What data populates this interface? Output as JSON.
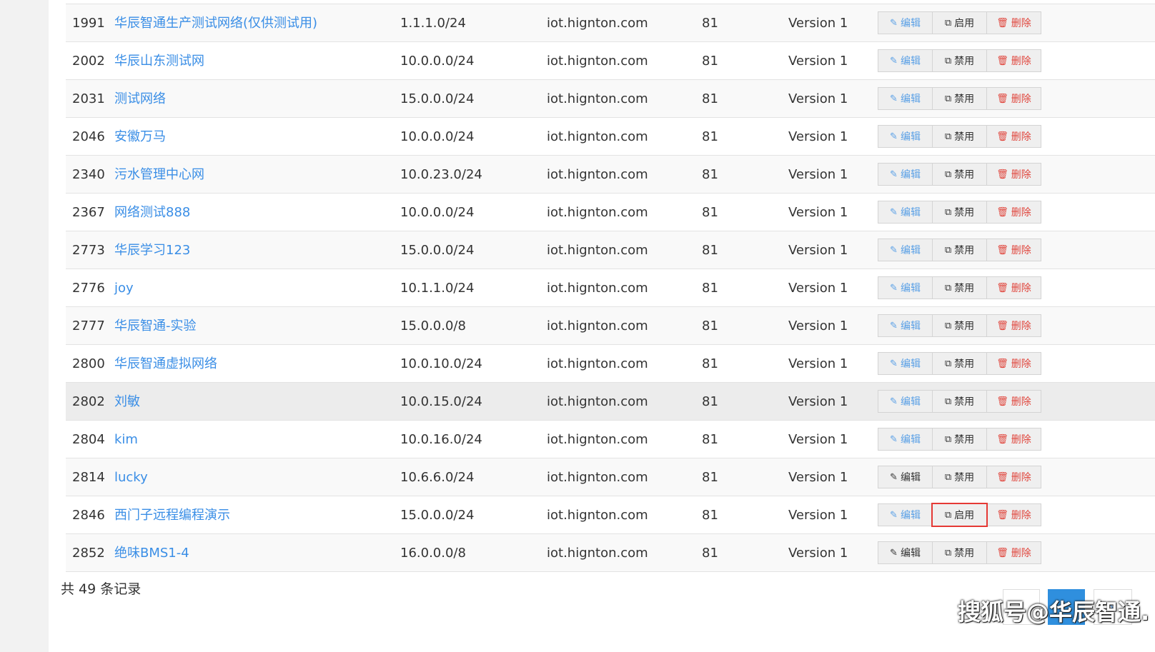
{
  "rows": [
    {
      "id": "1991",
      "name": "华辰智通生产测试网络(仅供测试用)",
      "cidr": "1.1.1.0/24",
      "host": "iot.hignton.com",
      "port": "81",
      "version": "Version 1",
      "toggle": "启用"
    },
    {
      "id": "2002",
      "name": "华辰山东测试网",
      "cidr": "10.0.0.0/24",
      "host": "iot.hignton.com",
      "port": "81",
      "version": "Version 1",
      "toggle": "禁用"
    },
    {
      "id": "2031",
      "name": "测试网络",
      "cidr": "15.0.0.0/24",
      "host": "iot.hignton.com",
      "port": "81",
      "version": "Version 1",
      "toggle": "禁用"
    },
    {
      "id": "2046",
      "name": "安徽万马",
      "cidr": "10.0.0.0/24",
      "host": "iot.hignton.com",
      "port": "81",
      "version": "Version 1",
      "toggle": "禁用"
    },
    {
      "id": "2340",
      "name": "污水管理中心网",
      "cidr": "10.0.23.0/24",
      "host": "iot.hignton.com",
      "port": "81",
      "version": "Version 1",
      "toggle": "禁用"
    },
    {
      "id": "2367",
      "name": "网络测试888",
      "cidr": "10.0.0.0/24",
      "host": "iot.hignton.com",
      "port": "81",
      "version": "Version 1",
      "toggle": "禁用"
    },
    {
      "id": "2773",
      "name": "华辰学习123",
      "cidr": "15.0.0.0/24",
      "host": "iot.hignton.com",
      "port": "81",
      "version": "Version 1",
      "toggle": "禁用"
    },
    {
      "id": "2776",
      "name": "joy",
      "cidr": "10.1.1.0/24",
      "host": "iot.hignton.com",
      "port": "81",
      "version": "Version 1",
      "toggle": "禁用"
    },
    {
      "id": "2777",
      "name": "华辰智通-实验",
      "cidr": "15.0.0.0/8",
      "host": "iot.hignton.com",
      "port": "81",
      "version": "Version 1",
      "toggle": "禁用"
    },
    {
      "id": "2800",
      "name": "华辰智通虚拟网络",
      "cidr": "10.0.10.0/24",
      "host": "iot.hignton.com",
      "port": "81",
      "version": "Version 1",
      "toggle": "禁用"
    },
    {
      "id": "2802",
      "name": "刘敏",
      "cidr": "10.0.15.0/24",
      "host": "iot.hignton.com",
      "port": "81",
      "version": "Version 1",
      "toggle": "禁用"
    },
    {
      "id": "2804",
      "name": "kim",
      "cidr": "10.0.16.0/24",
      "host": "iot.hignton.com",
      "port": "81",
      "version": "Version 1",
      "toggle": "禁用"
    },
    {
      "id": "2814",
      "name": "lucky",
      "cidr": "10.6.6.0/24",
      "host": "iot.hignton.com",
      "port": "81",
      "version": "Version 1",
      "toggle": "禁用"
    },
    {
      "id": "2846",
      "name": "西门子远程编程演示",
      "cidr": "15.0.0.0/24",
      "host": "iot.hignton.com",
      "port": "81",
      "version": "Version 1",
      "toggle": "启用"
    },
    {
      "id": "2852",
      "name": "绝味BMS1-4",
      "cidr": "16.0.0.0/8",
      "host": "iot.hignton.com",
      "port": "81",
      "version": "Version 1",
      "toggle": "禁用"
    }
  ],
  "actions": {
    "edit": "编辑",
    "delete": "删除"
  },
  "footer": {
    "total": "共 49 条记录",
    "next": "»"
  },
  "watermark": "搜狐号@华辰智通.",
  "icons": {
    "edit": "edit-icon",
    "toggle": "copy-icon",
    "delete": "trash-icon"
  },
  "colors": {
    "link": "#3a8ee6",
    "delete": "#e0453c",
    "pager_active": "#2f8fde",
    "highlight": "#e53935"
  }
}
